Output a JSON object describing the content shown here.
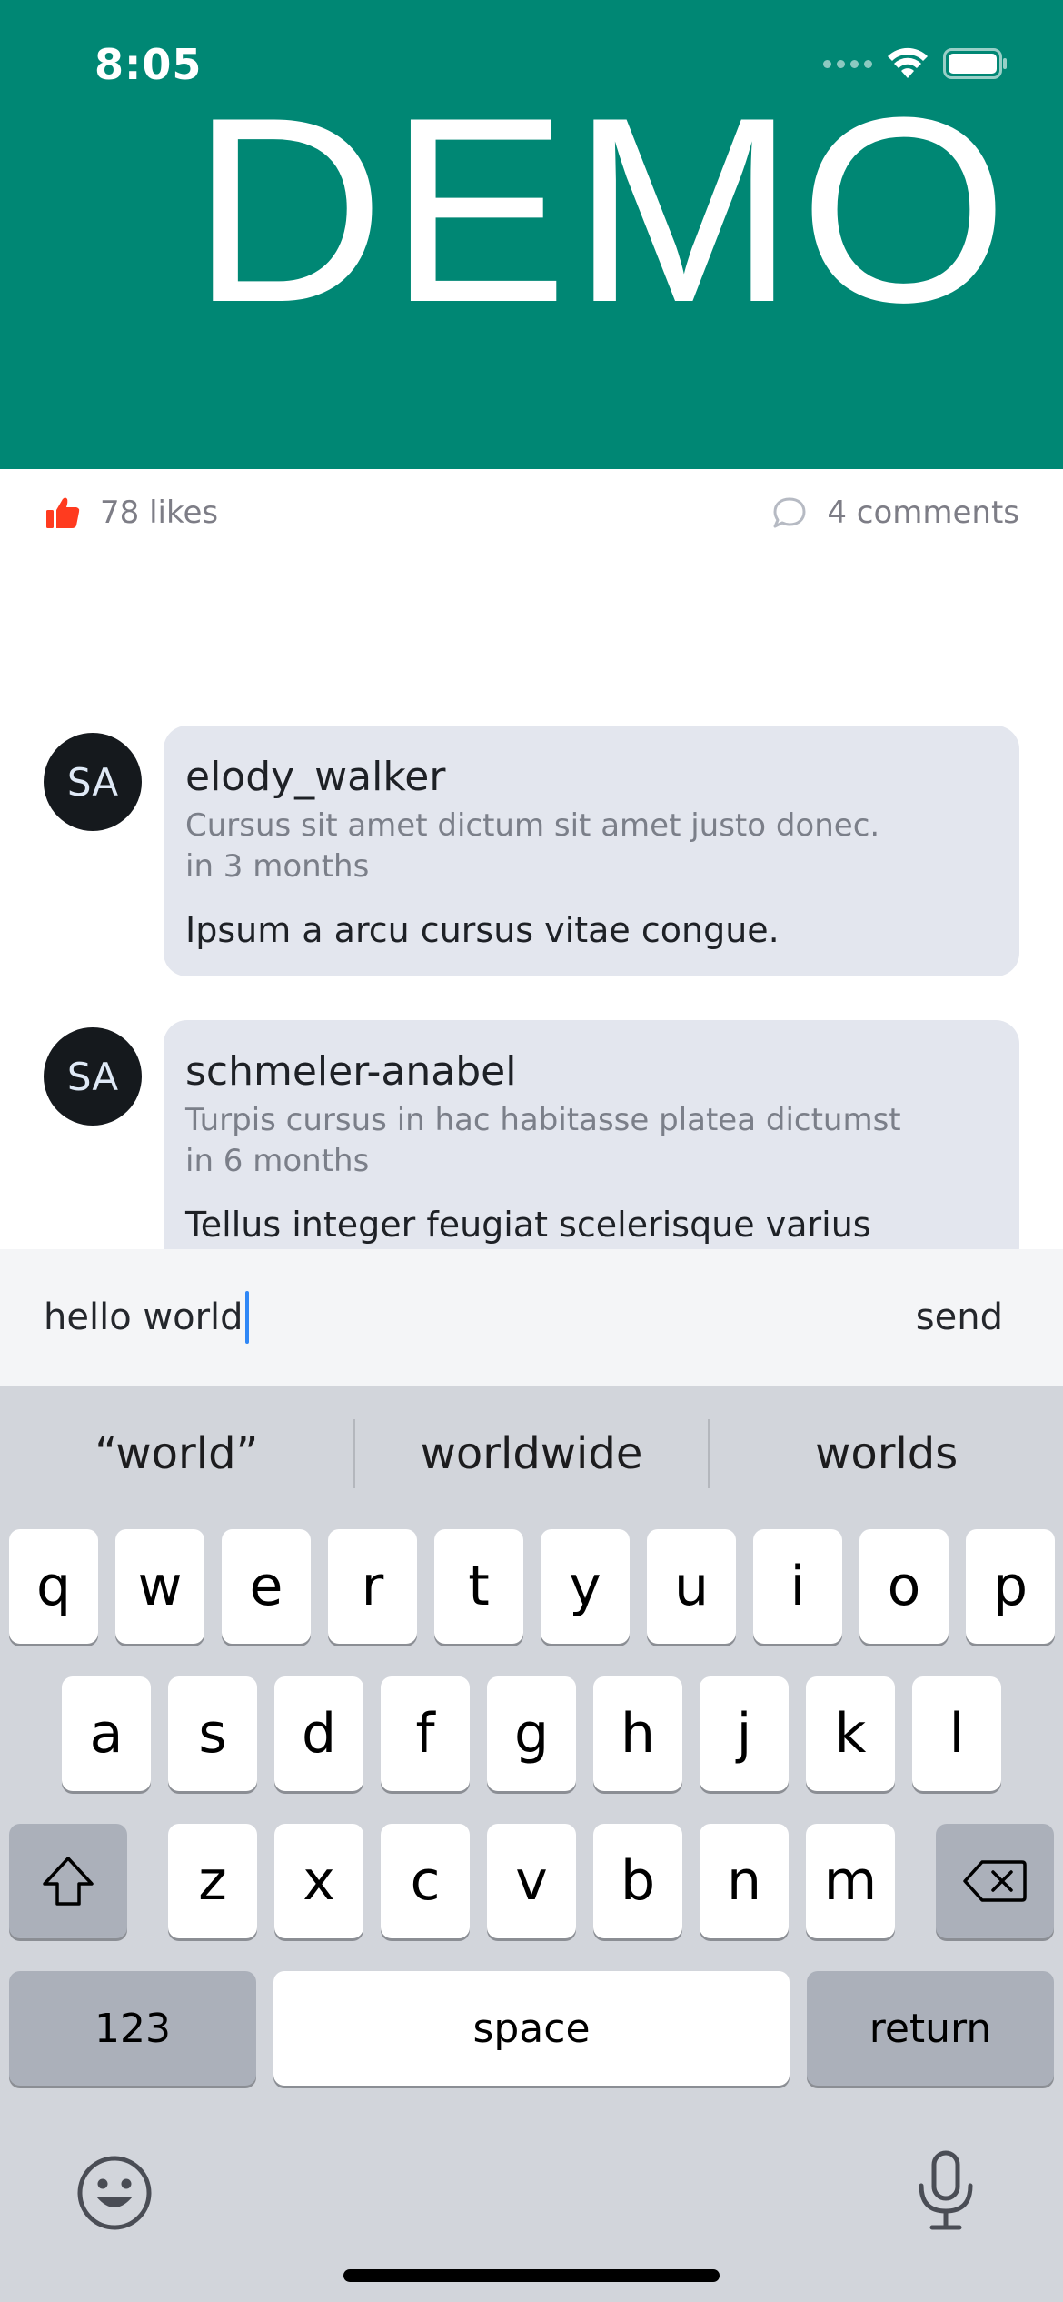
{
  "status_bar": {
    "time": "8:05",
    "icons": [
      "cellular-signal-icon",
      "wifi-icon",
      "battery-icon"
    ]
  },
  "hero": {
    "title": "DEMO",
    "background_color": "#008774"
  },
  "stats": {
    "likes": "78 likes",
    "comments": "4 comments",
    "like_icon": "thumbs-up-icon",
    "comment_icon": "comment-bubble-icon",
    "like_color": "#ff3b1f"
  },
  "comments": [
    {
      "avatar": "SA",
      "username": "elody_walker",
      "subtitle": "Cursus sit amet dictum sit amet justo donec.",
      "time": "in 3 months",
      "body": "Ipsum a arcu cursus vitae congue."
    },
    {
      "avatar": "SA",
      "username": "schmeler-anabel",
      "subtitle": "Turpis cursus in hac habitasse platea dictumst",
      "time": "in 6 months",
      "body": "Tellus integer feugiat scelerisque varius"
    }
  ],
  "composer": {
    "value": "hello world",
    "send_label": "send"
  },
  "keyboard": {
    "suggestions": [
      "“world”",
      "worldwide",
      "worlds"
    ],
    "row1": [
      "q",
      "w",
      "e",
      "r",
      "t",
      "y",
      "u",
      "i",
      "o",
      "p"
    ],
    "row2": [
      "a",
      "s",
      "d",
      "f",
      "g",
      "h",
      "j",
      "k",
      "l"
    ],
    "row3": [
      "z",
      "x",
      "c",
      "v",
      "b",
      "n",
      "m"
    ],
    "numbers_label": "123",
    "space_label": "space",
    "return_label": "return",
    "bottom_icons": [
      "emoji-icon",
      "microphone-icon"
    ]
  }
}
